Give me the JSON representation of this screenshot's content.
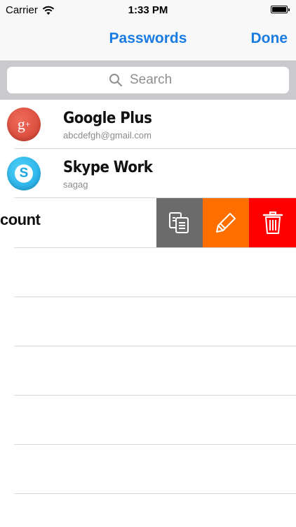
{
  "status": {
    "carrier": "Carrier",
    "time": "1:33 PM"
  },
  "nav": {
    "title": "Passwords",
    "done": "Done"
  },
  "search": {
    "placeholder": "Search"
  },
  "items": [
    {
      "title": "Google Plus",
      "subtitle": "abcdefgh@gmail.com",
      "icon": "google-plus-icon",
      "color": "#dd4b39"
    },
    {
      "title": "Skype Work",
      "subtitle": "sagag",
      "icon": "skype-icon",
      "color": "#00aff0"
    },
    {
      "title": "count",
      "subtitle": ""
    }
  ],
  "actions": {
    "copy": {
      "icon": "copy-icon",
      "color": "#6b6b6b"
    },
    "edit": {
      "icon": "pencil-icon",
      "color": "#ff6f00"
    },
    "delete": {
      "icon": "trash-icon",
      "color": "#ff0000"
    }
  },
  "accent_color": "#1a7be0"
}
